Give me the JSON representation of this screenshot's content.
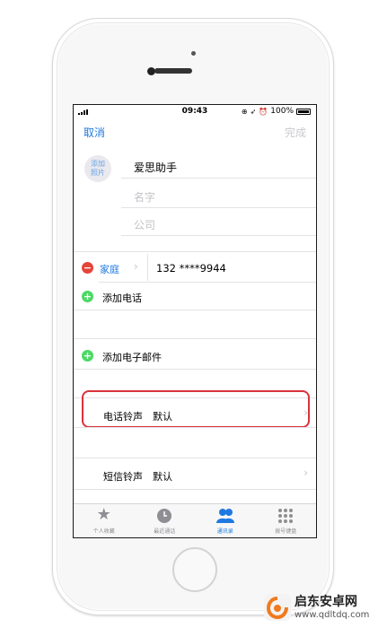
{
  "status_bar": {
    "time": "09:43",
    "battery": "100%"
  },
  "nav": {
    "cancel": "取消",
    "done": "完成"
  },
  "photo": {
    "line1": "添加",
    "line2": "照片"
  },
  "contact": {
    "name": "爱思助手",
    "name_placeholder": "名字",
    "company_placeholder": "公司"
  },
  "phone": {
    "label": "家庭",
    "number": "132 ****9944"
  },
  "actions": {
    "add_phone": "添加电话",
    "add_email": "添加电子邮件"
  },
  "ringtone": {
    "label": "电话铃声",
    "value": "默认"
  },
  "text_tone": {
    "label": "短信铃声",
    "value": "默认"
  },
  "tabs": [
    {
      "label": "个人收藏",
      "icon": "star-icon"
    },
    {
      "label": "最近通话",
      "icon": "clock-icon"
    },
    {
      "label": "通讯录",
      "icon": "contacts-icon",
      "active": true
    },
    {
      "label": "拨号键盘",
      "icon": "keypad-icon"
    }
  ],
  "watermark": {
    "title": "启东安卓网",
    "url": "www.qdltdq.com"
  },
  "colors": {
    "accent": "#1f7ae0",
    "delete": "#e5443a",
    "add": "#4cd964",
    "highlight": "#d9323b"
  }
}
